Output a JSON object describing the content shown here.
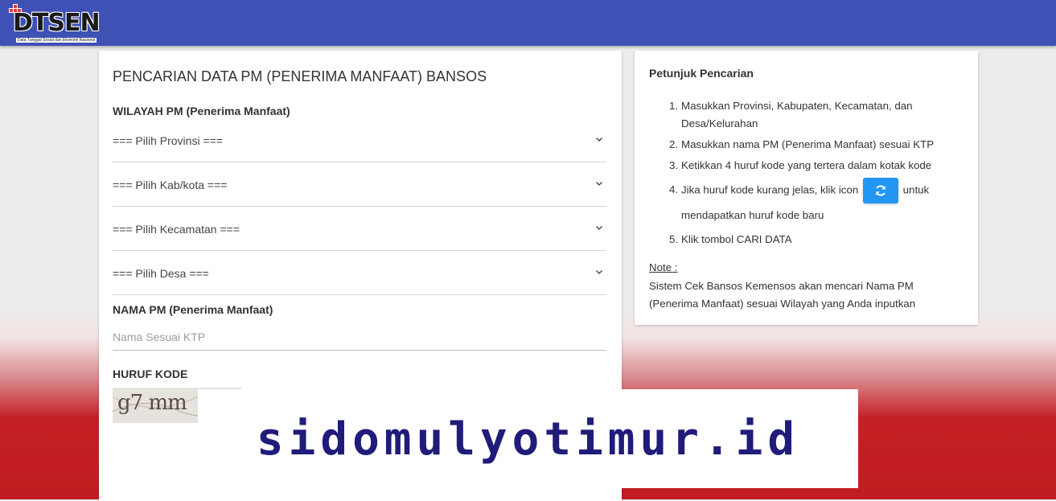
{
  "header": {
    "logo_text": "DTSEN",
    "logo_tagline": "Data Tunggal Sosial dan Ekonomi Nasional",
    "bar_color": "#3f51b5"
  },
  "form": {
    "title": "PENCARIAN DATA PM (PENERIMA MANFAAT) BANSOS",
    "region_label": "WILAYAH PM (Penerima Manfaat)",
    "province_select": "=== Pilih Provinsi ===",
    "regency_select": "=== Pilih Kab/kota ===",
    "district_select": "=== Pilih Kecamatan ===",
    "village_select": "=== Pilih Desa ===",
    "name_label": "NAMA PM (Penerima Manfaat)",
    "name_placeholder": "Nama Sesuai KTP",
    "code_label": "HURUF KODE",
    "captcha_text": "g7 mm",
    "chevron_icon": "chevron-down-icon"
  },
  "help": {
    "title": "Petunjuk Pencarian",
    "steps": [
      {
        "num": "1.",
        "text": "Masukkan Provinsi, Kabupaten, Kecamatan, dan Desa/Kelurahan"
      },
      {
        "num": "2.",
        "text": "Masukkan nama PM (Penerima Manfaat) sesuai KTP"
      },
      {
        "num": "3.",
        "text": "Ketikkan 4 huruf kode yang tertera dalam kotak kode"
      },
      {
        "num": "4.",
        "text_before": "Jika huruf kode kurang jelas, klik icon",
        "text_after": "untuk mendapatkan huruf kode baru"
      },
      {
        "num": "5.",
        "text": "Klik tombol CARI DATA"
      }
    ],
    "refresh_icon": "refresh-icon",
    "refresh_color": "#2196f3",
    "note_label": "Note :",
    "note_text": "Sistem Cek Bansos Kemensos akan mencari Nama PM (Penerima Manfaat) sesuai Wilayah yang Anda inputkan"
  },
  "watermark": {
    "text": "sidomulyotimur.id",
    "color": "#1f1c7a"
  }
}
